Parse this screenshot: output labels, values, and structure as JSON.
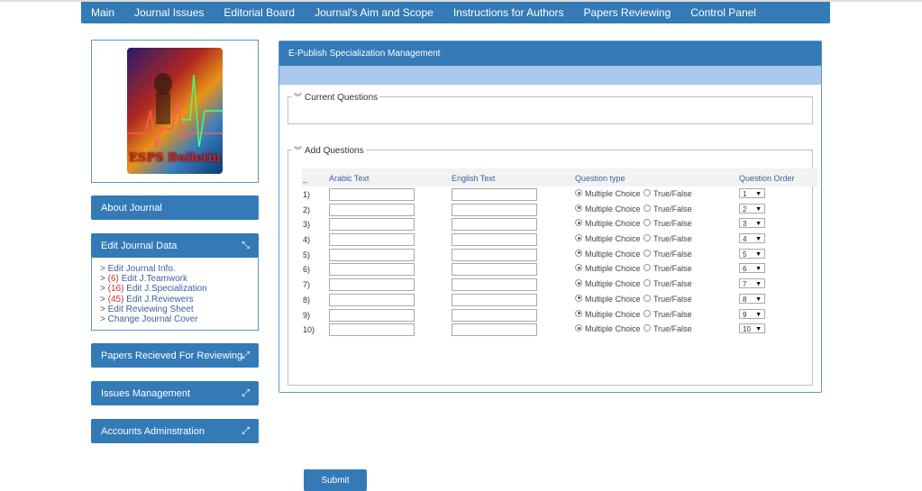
{
  "nav": {
    "items": [
      "Main",
      "Journal Issues",
      "Editorial Board",
      "Journal's Aim and Scope",
      "Instructions for Authors",
      "Papers Reviewing",
      "Control Panel"
    ]
  },
  "cover": {
    "title": "ESPS Bulletin"
  },
  "sidebar": {
    "about": "About Journal",
    "edit_data": {
      "title": "Edit Journal Data",
      "links": [
        {
          "count": "",
          "label": "Edit Journal Info."
        },
        {
          "count": "(6)",
          "label": "Edit J.Teamwork"
        },
        {
          "count": "(16)",
          "label": "Edit J.Specialization"
        },
        {
          "count": "(45)",
          "label": "Edit J.Reviewers"
        },
        {
          "count": "",
          "label": "Edit Reviewing Sheet"
        },
        {
          "count": "",
          "label": "Change Journal Cover"
        }
      ]
    },
    "papers": "Papers Recieved For Reviewing",
    "issues": "Issues Management",
    "accounts": "Accounts Adminstration"
  },
  "main": {
    "header": "E-Publish Specialization Management",
    "current_questions": "Current Questions",
    "add_questions": "Add Questions",
    "columns": {
      "index": "_",
      "arabic": "Arabic Text",
      "english": "English Text",
      "type": "Question type",
      "order": "Question Order"
    },
    "type_options": [
      "Multiple Choice",
      "True/False"
    ],
    "rows": [
      {
        "num": "1)",
        "order": "1"
      },
      {
        "num": "2)",
        "order": "2"
      },
      {
        "num": "3)",
        "order": "3"
      },
      {
        "num": "4)",
        "order": "4"
      },
      {
        "num": "5)",
        "order": "5"
      },
      {
        "num": "6)",
        "order": "6"
      },
      {
        "num": "7)",
        "order": "7"
      },
      {
        "num": "8)",
        "order": "8"
      },
      {
        "num": "9)",
        "order": "9"
      },
      {
        "num": "10)",
        "order": "10"
      }
    ],
    "submit_label": "Submit"
  },
  "colors": {
    "primary": "#337ab7",
    "subbar": "#a8c8ec",
    "count": "#c0392b"
  }
}
